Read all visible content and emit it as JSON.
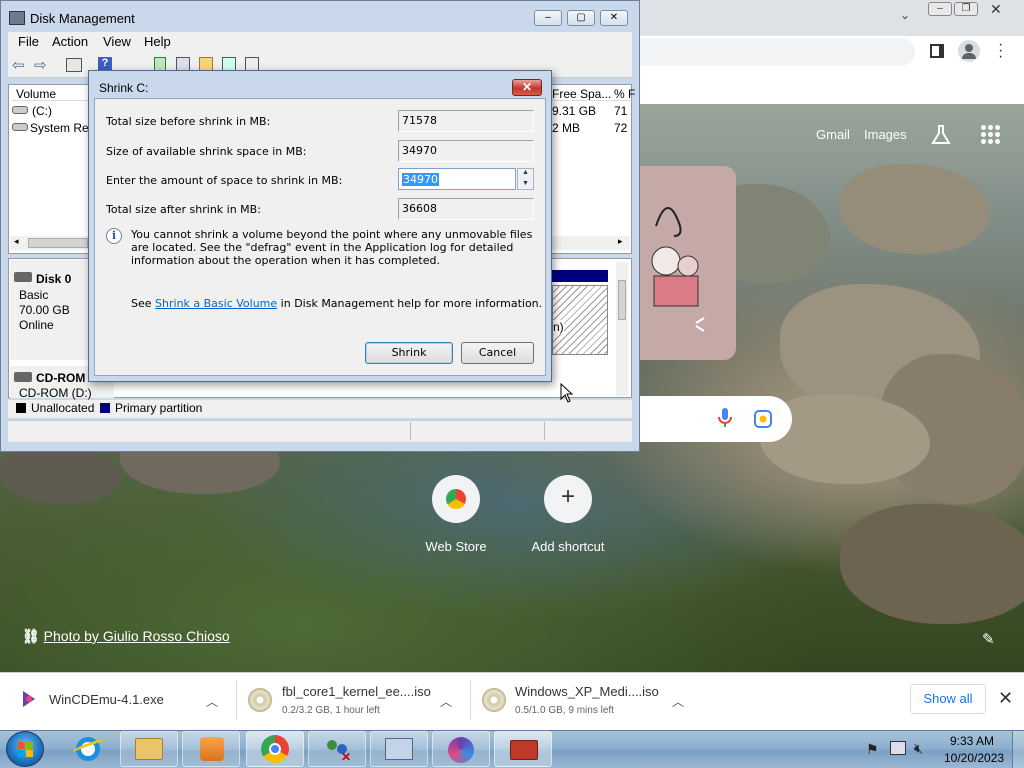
{
  "chrome": {
    "gmail": "Gmail",
    "images": "Images",
    "shortcuts": [
      {
        "label": "Web Store",
        "icon": "chrome-web-store-icon"
      },
      {
        "label": "Add shortcut",
        "icon": "plus-icon"
      }
    ],
    "photo_credit": "Photo by Giulio Rosso Chioso"
  },
  "downloads": {
    "items": [
      {
        "name": "WinCDEmu-4.1.exe",
        "sub": ""
      },
      {
        "name": "fbl_core1_kernel_ee....iso",
        "sub": "0.2/3.2 GB, 1 hour left"
      },
      {
        "name": "Windows_XP_Medi....iso",
        "sub": "0.5/1.0 GB, 9 mins left"
      }
    ],
    "show_all": "Show all"
  },
  "taskbar": {
    "time": "9:33 AM",
    "date": "10/20/2023"
  },
  "disk_mgmt": {
    "title": "Disk Management",
    "menu": [
      "File",
      "Action",
      "View",
      "Help"
    ],
    "columns": {
      "volume": "Volume",
      "free": "Free Spa...",
      "pct": "% F"
    },
    "rows": [
      {
        "name": "(C:)",
        "free": "9.31 GB",
        "pct": "71"
      },
      {
        "name": "System Res",
        "free": "2 MB",
        "pct": "72"
      }
    ],
    "disk0": {
      "name": "Disk 0",
      "type": "Basic",
      "size": "70.00 GB",
      "status": "Online"
    },
    "cdrom": {
      "name": "CD-ROM 0",
      "drive": "CD-ROM (D:)"
    },
    "partial_text": "n)",
    "legend": {
      "unallocated": "Unallocated",
      "primary": "Primary partition"
    },
    "colors": {
      "unallocated": "#000000",
      "primary": "#000080"
    }
  },
  "shrink": {
    "title": "Shrink C:",
    "fields": [
      {
        "label": "Total size before shrink in MB:",
        "value": "71578"
      },
      {
        "label": "Size of available shrink space in MB:",
        "value": "34970"
      },
      {
        "label": "Enter the amount of space to shrink in MB:",
        "value": "34970"
      },
      {
        "label": "Total size after shrink in MB:",
        "value": "36608"
      }
    ],
    "info": "You cannot shrink a volume beyond the point where any unmovable files are located. See the \"defrag\" event in the Application log for detailed information about the operation when it has completed.",
    "see_prefix": "See",
    "see_link": "Shrink a Basic Volume",
    "see_suffix": "in Disk Management help for more information.",
    "ok": "Shrink",
    "cancel": "Cancel"
  }
}
